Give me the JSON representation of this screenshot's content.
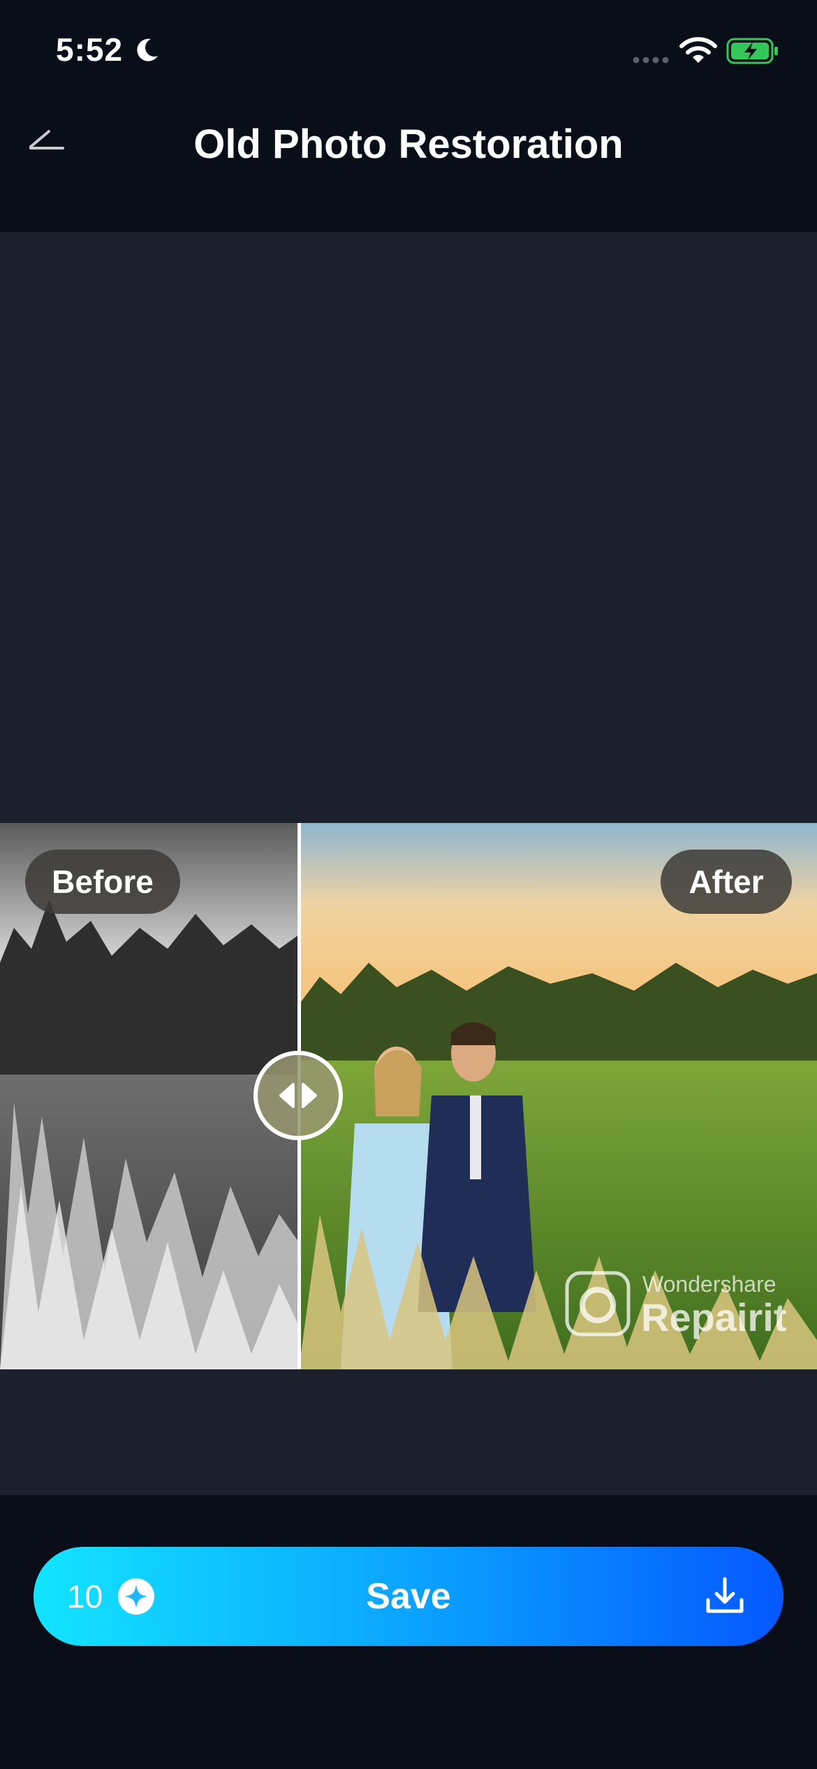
{
  "status_bar": {
    "time": "5:52",
    "icons": [
      "moon-icon",
      "cellular-icon",
      "wifi-icon",
      "battery-charging-icon"
    ],
    "battery_color": "#34c759"
  },
  "header": {
    "title": "Old Photo Restoration",
    "back_icon": "back-arrow-icon"
  },
  "comparison": {
    "before_label": "Before",
    "after_label": "After",
    "slider_position_percent": 36.6,
    "watermark": {
      "line1": "Wondershare",
      "line2": "Repairit"
    }
  },
  "save_bar": {
    "credits": "10",
    "credit_icon": "sparkle-icon",
    "save_label": "Save",
    "download_icon": "download-icon",
    "gradient": [
      "#13e4ff",
      "#0558ff"
    ]
  },
  "colors": {
    "background": "#0a0e18",
    "content_background": "#1c202d"
  }
}
